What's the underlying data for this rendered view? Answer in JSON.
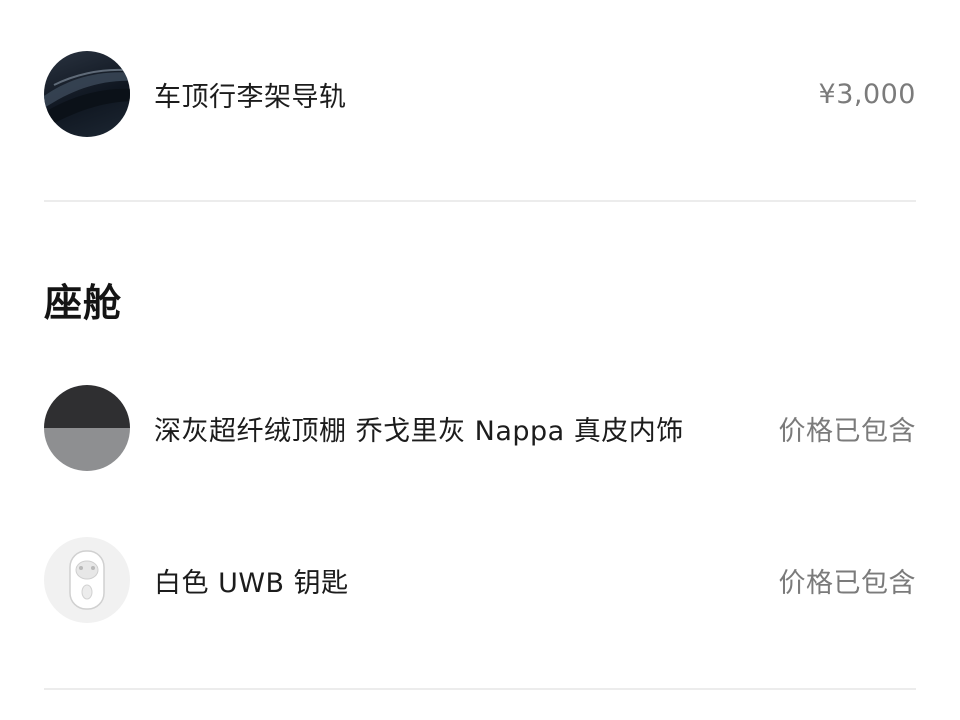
{
  "accessories": {
    "items": [
      {
        "name": "车顶行李架导轨",
        "price": "¥3,000",
        "image": "roof-rack-rail"
      }
    ]
  },
  "cabin": {
    "title": "座舱",
    "items": [
      {
        "name": "深灰超纤绒顶棚 乔戈里灰 Nappa 真皮内饰",
        "price": "价格已包含",
        "image": "interior-swatch"
      },
      {
        "name": "白色 UWB 钥匙",
        "price": "价格已包含",
        "image": "uwb-key-white"
      }
    ]
  },
  "colors": {
    "price_gray": "#7b7b7b",
    "divider": "#ececec",
    "swatch_top": "#2f2f31",
    "swatch_bottom": "#8e8f91"
  }
}
